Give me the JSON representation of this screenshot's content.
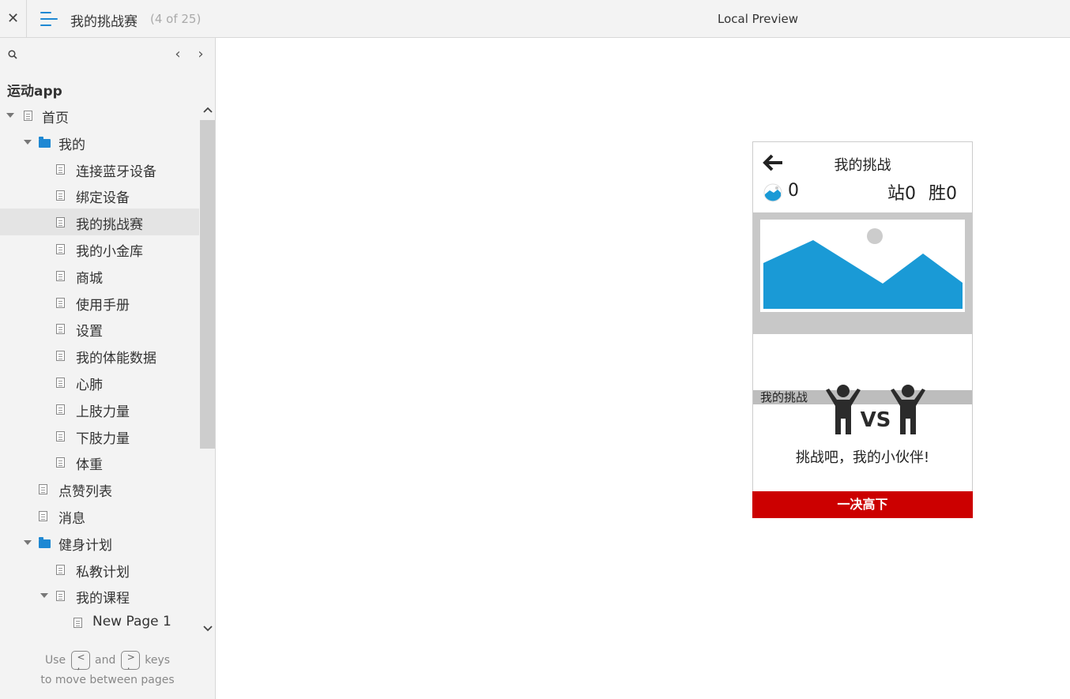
{
  "header": {
    "close_label": "✕",
    "page_title": "我的挑战赛",
    "page_count": "(4 of 25)",
    "preview_title": "Local Preview"
  },
  "sidebar": {
    "project_name": "运动app",
    "nav_prev": "‹",
    "nav_next": "›",
    "items": [
      {
        "label": "首页",
        "type": "page",
        "depth": 0,
        "caret": true
      },
      {
        "label": "我的",
        "type": "folder",
        "depth": 1,
        "caret": true
      },
      {
        "label": "连接蓝牙设备",
        "type": "page",
        "depth": 2,
        "caret": false
      },
      {
        "label": "绑定设备",
        "type": "page",
        "depth": 2,
        "caret": false
      },
      {
        "label": "我的挑战赛",
        "type": "page",
        "depth": 2,
        "caret": false,
        "selected": true
      },
      {
        "label": "我的小金库",
        "type": "page",
        "depth": 2,
        "caret": false
      },
      {
        "label": "商城",
        "type": "page",
        "depth": 2,
        "caret": false
      },
      {
        "label": "使用手册",
        "type": "page",
        "depth": 2,
        "caret": false
      },
      {
        "label": "设置",
        "type": "page",
        "depth": 2,
        "caret": false
      },
      {
        "label": "我的体能数据",
        "type": "page",
        "depth": 2,
        "caret": false
      },
      {
        "label": "心肺",
        "type": "page",
        "depth": 2,
        "caret": false
      },
      {
        "label": "上肢力量",
        "type": "page",
        "depth": 2,
        "caret": false
      },
      {
        "label": "下肢力量",
        "type": "page",
        "depth": 2,
        "caret": false
      },
      {
        "label": "体重",
        "type": "page",
        "depth": 2,
        "caret": false
      },
      {
        "label": "点赞列表",
        "type": "page",
        "depth": 1,
        "caret": false
      },
      {
        "label": "消息",
        "type": "page",
        "depth": 1,
        "caret": false
      },
      {
        "label": "健身计划",
        "type": "folder",
        "depth": 1,
        "caret": true
      },
      {
        "label": "私教计划",
        "type": "page",
        "depth": 2,
        "caret": false
      },
      {
        "label": "我的课程",
        "type": "page",
        "depth": 2,
        "caret": true
      },
      {
        "label": "New Page 1",
        "type": "page",
        "depth": 3,
        "caret": false
      }
    ],
    "help": {
      "use": "Use",
      "and": "and",
      "keys": "keys",
      "line2": "to move between pages",
      "key_prev": "<\n,",
      "key_next": ">\n."
    }
  },
  "phone": {
    "title": "我的挑战",
    "coins": "0",
    "zhan": "站0",
    "sheng": "胜0",
    "banner_caption": "我的挑战",
    "vs_label": "VS",
    "slogan": "挑战吧，我的小伙伴!",
    "cta": "一决高下",
    "colors": {
      "accent": "#1e88d3",
      "image_blue": "#1a9ad6",
      "cta_red": "#cc0000"
    }
  }
}
